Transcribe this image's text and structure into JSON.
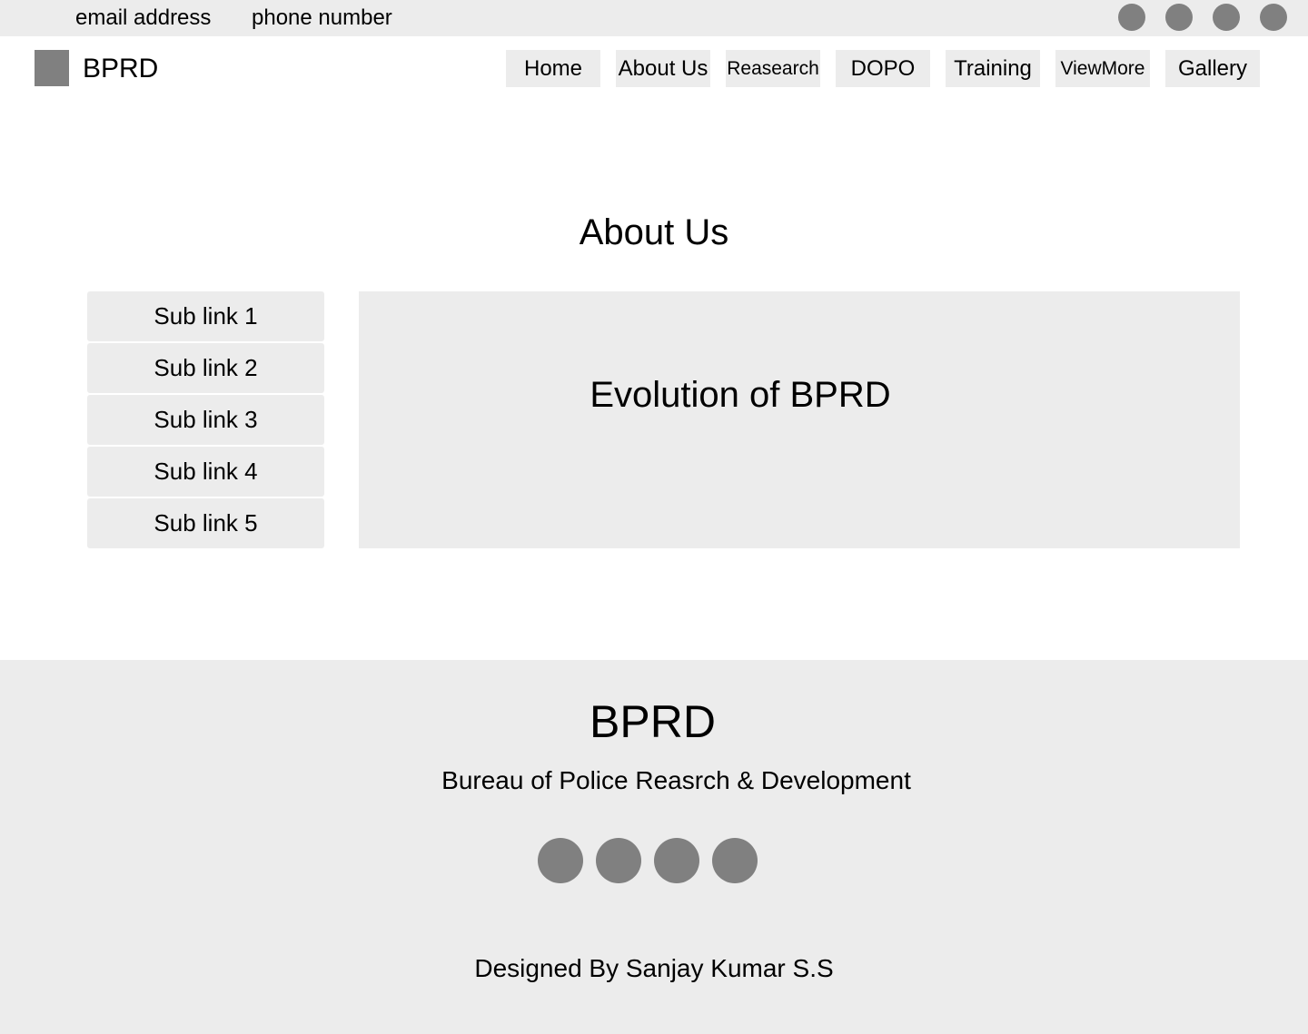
{
  "topbar": {
    "email_label": "email address",
    "phone_label": "phone number",
    "social_icons": [
      "social-icon",
      "social-icon",
      "social-icon",
      "social-icon"
    ]
  },
  "header": {
    "brand": "BPRD",
    "nav": [
      "Home",
      "About Us",
      "Reasearch",
      "DOPO",
      "Training",
      "ViewMore",
      "Gallery"
    ]
  },
  "main": {
    "title": "About Us",
    "sublinks": [
      "Sub link 1",
      "Sub link 2",
      "Sub link 3",
      "Sub link 4",
      "Sub link 5"
    ],
    "content_heading": "Evolution of BPRD"
  },
  "footer": {
    "brand": "BPRD",
    "subtitle": "Bureau of Police Reasrch & Development",
    "social_icons": [
      "social-icon",
      "social-icon",
      "social-icon",
      "social-icon"
    ],
    "credit": "Designed By Sanjay Kumar S.S"
  },
  "colors": {
    "panel_background": "#ececec",
    "placeholder_gray": "#808080",
    "text": "#000000"
  }
}
